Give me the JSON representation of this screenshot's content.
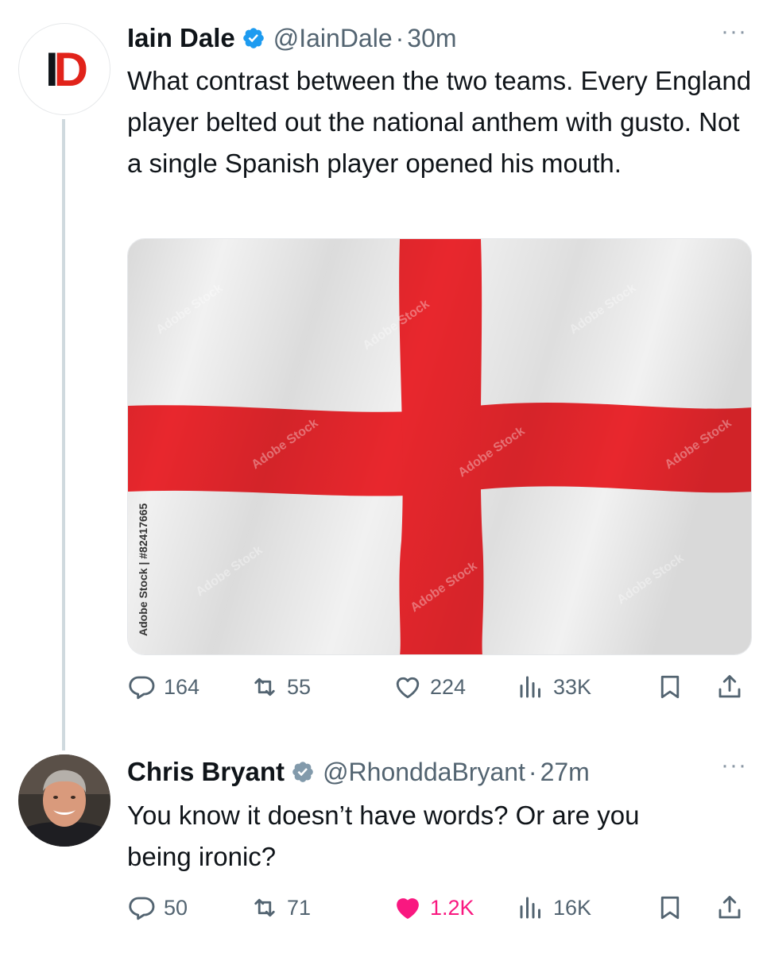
{
  "tweets": [
    {
      "author_name": "Iain Dale",
      "handle": "@IainDale",
      "separator": "·",
      "time": "30m",
      "avatar_initials_1": "I",
      "avatar_initials_2": "D",
      "text": "What contrast between the two teams. Every England player belted out the national anthem with gusto. Not a single Spanish player opened his mouth.",
      "media": {
        "watermark": "Adobe Stock | #82417665",
        "image_text": "Adobe Stock",
        "colors": {
          "field": "#f1f1f1",
          "cross": "#e8272d"
        }
      },
      "stats": {
        "replies": "164",
        "reposts": "55",
        "likes": "224",
        "views": "33K"
      },
      "liked": false
    },
    {
      "author_name": "Chris Bryant",
      "handle": "@RhonddaBryant",
      "separator": "·",
      "time": "27m",
      "text": "You know it doesn’t have words? Or are you being ironic?",
      "stats": {
        "replies": "50",
        "reposts": "71",
        "likes": "1.2K",
        "views": "16K"
      },
      "liked": true
    }
  ],
  "more_label": "···",
  "colors": {
    "verified": "#1d9bf0",
    "like": "#f91880",
    "muted": "#536471"
  },
  "icons": [
    "verified-badge-icon",
    "reply-icon",
    "repost-icon",
    "like-icon",
    "views-icon",
    "bookmark-icon",
    "share-icon",
    "more-icon"
  ]
}
